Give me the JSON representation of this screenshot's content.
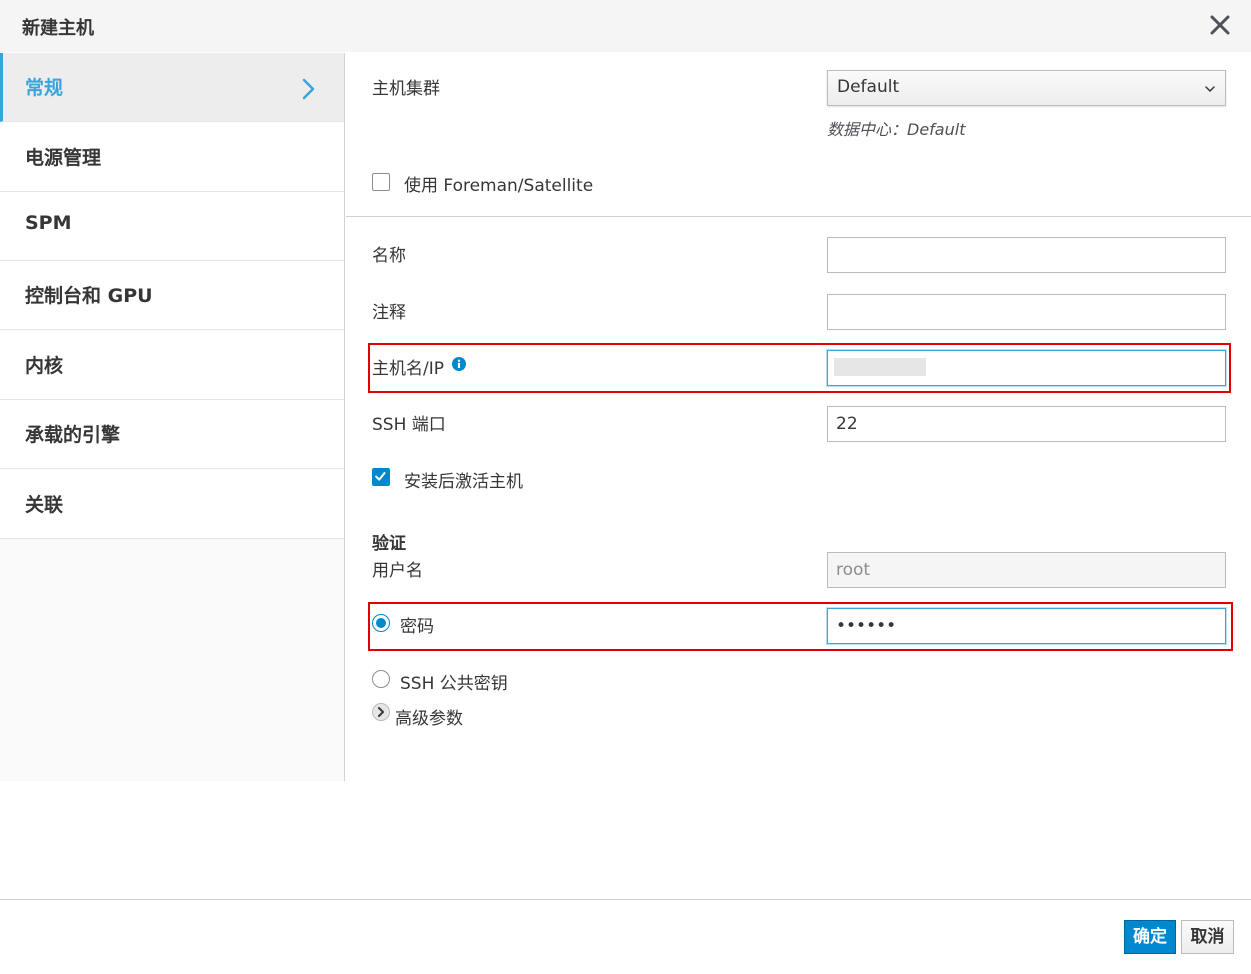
{
  "dialog": {
    "title": "新建主机"
  },
  "sidebar": {
    "items": [
      {
        "label": "常规",
        "active": true
      },
      {
        "label": "电源管理"
      },
      {
        "label": "SPM"
      },
      {
        "label": "控制台和 GPU"
      },
      {
        "label": "内核"
      },
      {
        "label": "承载的引擎"
      },
      {
        "label": "关联"
      }
    ]
  },
  "form": {
    "cluster": {
      "label": "主机集群",
      "value": "Default",
      "help": "数据中心：Default"
    },
    "foreman": {
      "label": "使用 Foreman/Satellite",
      "checked": false
    },
    "name": {
      "label": "名称",
      "value": ""
    },
    "comment": {
      "label": "注释",
      "value": ""
    },
    "hostname": {
      "label": "主机名/IP",
      "value": ""
    },
    "ssh_port": {
      "label": "SSH 端口",
      "value": "22"
    },
    "activate": {
      "label": "安装后激活主机",
      "checked": true
    },
    "auth": {
      "title": "验证",
      "username_label": "用户名",
      "username_value": "root",
      "password_label": "密码",
      "password_value": "••••••",
      "ssh_key_label": "SSH 公共密钥"
    },
    "advanced": {
      "label": "高级参数"
    }
  },
  "footer": {
    "ok_label": "确定",
    "cancel_label": "取消"
  },
  "colors": {
    "accent": "#39a5dc",
    "primary": "#0088ce",
    "highlight": "#e00000"
  }
}
